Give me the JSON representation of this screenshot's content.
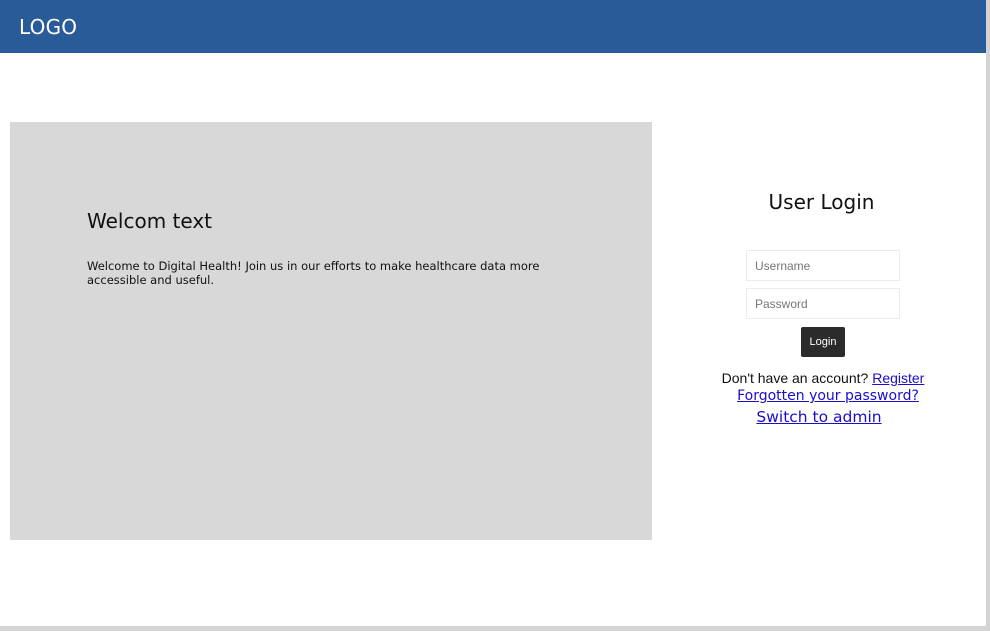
{
  "header": {
    "logo_text": "LOGO",
    "background_color": "#2a5b99"
  },
  "welcome": {
    "title": "Welcom text",
    "body": "Welcome to Digital Health! Join us in our efforts to make healthcare data more accessible and useful.",
    "panel_color": "#d8d8d8"
  },
  "login": {
    "title": "User Login",
    "username": {
      "placeholder": "Username",
      "value": ""
    },
    "password": {
      "placeholder": "Password",
      "value": ""
    },
    "button_label": "Login",
    "register_prompt": "Don't have an account? ",
    "register_link": "Register",
    "forgot_link": "Forgotten your password?",
    "admin_link": "Switch to admin",
    "link_color": "#1a0dcc"
  }
}
